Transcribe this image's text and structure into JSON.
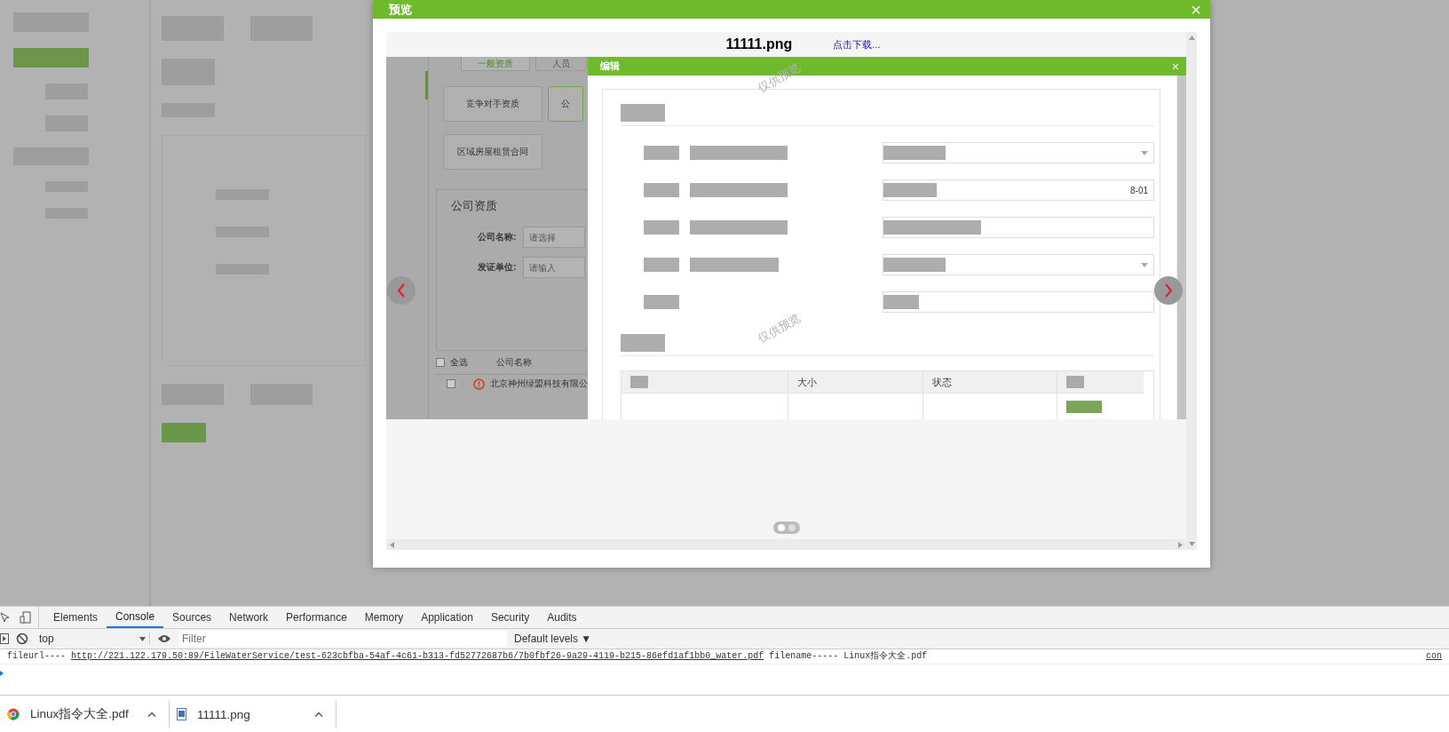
{
  "modal": {
    "title": "预览",
    "close": "×"
  },
  "preview": {
    "file_name": "11111.png",
    "download_link": "点击下载...",
    "image": {
      "tabs": [
        {
          "label": "一般资质",
          "selected": true
        },
        {
          "label": "人员",
          "selected": false
        }
      ],
      "category_buttons": [
        {
          "label": "竞争对手资质",
          "selected": false
        },
        {
          "label": "公",
          "selected": true
        },
        {
          "label": "区域房屋租赁合同",
          "selected": false
        }
      ],
      "section_title": "公司资质",
      "fields": [
        {
          "label": "公司名称:",
          "placeholder": "请选择"
        },
        {
          "label": "发证单位:",
          "placeholder": "请输入"
        }
      ],
      "table": {
        "select_all": "全选",
        "select_all_checked": false,
        "columns": [
          "公司名称"
        ],
        "rows": [
          {
            "checked": false,
            "cells": [
              "北京神州绿盟科技有限公"
            ]
          }
        ]
      },
      "edit_dialog": {
        "title": "编辑",
        "close": "×",
        "watermarks": [
          "仅供预览",
          "仅供预览"
        ],
        "date_fragment": "8-01",
        "file_table": {
          "columns": [
            "大小",
            "状态"
          ]
        }
      }
    },
    "slides": [
      {
        "selected": true
      },
      {
        "selected": false
      }
    ]
  },
  "devtools": {
    "tabs": [
      {
        "label": "Elements",
        "selected": false
      },
      {
        "label": "Console",
        "selected": true
      },
      {
        "label": "Sources",
        "selected": false
      },
      {
        "label": "Network",
        "selected": false
      },
      {
        "label": "Performance",
        "selected": false
      },
      {
        "label": "Memory",
        "selected": false
      },
      {
        "label": "Application",
        "selected": false
      },
      {
        "label": "Security",
        "selected": false
      },
      {
        "label": "Audits",
        "selected": false
      }
    ],
    "context": "top",
    "filter_placeholder": "Filter",
    "levels": "Default levels ▼",
    "log": {
      "prefix": "fileurl----",
      "url": "http://221.122.179.50:89/FileWaterService/test-623cbfba-54af-4c61-b313-fd52772687b6/7b0fbf26-9a29-4119-b215-86efd1af1bb0_water.pdf",
      "suffix": "filename----- Linux指令大全.pdf",
      "source": "con"
    }
  },
  "downloads": [
    {
      "name": "Linux指令大全.pdf",
      "kind": "pdf"
    },
    {
      "name": "11111.png",
      "kind": "image"
    }
  ]
}
